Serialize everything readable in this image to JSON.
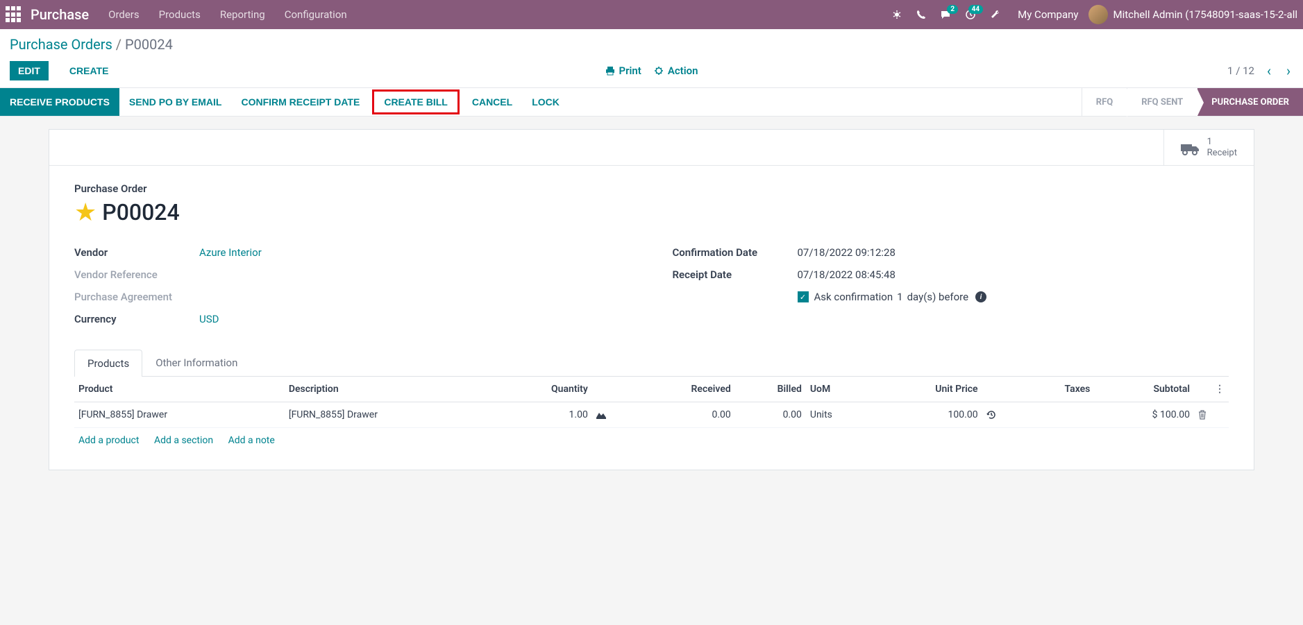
{
  "navbar": {
    "brand": "Purchase",
    "links": [
      "Orders",
      "Products",
      "Reporting",
      "Configuration"
    ],
    "badge_msg": "2",
    "badge_clock": "44",
    "company": "My Company",
    "user": "Mitchell Admin (17548091-saas-15-2-all"
  },
  "breadcrumb": {
    "root": "Purchase Orders",
    "current": "P00024"
  },
  "buttons": {
    "edit": "Edit",
    "create": "Create",
    "print": "Print",
    "action": "Action"
  },
  "pager": {
    "text": "1 / 12"
  },
  "actions": {
    "receive": "Receive Products",
    "send": "Send PO by Email",
    "confirm": "Confirm Receipt Date",
    "create_bill": "Create Bill",
    "cancel": "Cancel",
    "lock": "Lock"
  },
  "status": {
    "rfq": "RFQ",
    "sent": "RFQ SENT",
    "po": "PURCHASE ORDER"
  },
  "stat": {
    "count": "1",
    "label": "Receipt"
  },
  "order": {
    "title_label": "Purchase Order",
    "name": "P00024",
    "vendor_label": "Vendor",
    "vendor": "Azure Interior",
    "vendor_ref_label": "Vendor Reference",
    "agreement_label": "Purchase Agreement",
    "currency_label": "Currency",
    "currency": "USD",
    "confirm_date_label": "Confirmation Date",
    "confirm_date": "07/18/2022 09:12:28",
    "receipt_date_label": "Receipt Date",
    "receipt_date": "07/18/2022 08:45:48",
    "ask_confirm_prefix": "Ask confirmation",
    "ask_confirm_days": "1",
    "ask_confirm_suffix": "day(s) before"
  },
  "tabs": {
    "products": "Products",
    "other": "Other Information"
  },
  "table": {
    "headers": {
      "product": "Product",
      "desc": "Description",
      "qty": "Quantity",
      "recv": "Received",
      "billed": "Billed",
      "uom": "UoM",
      "price": "Unit Price",
      "taxes": "Taxes",
      "subtotal": "Subtotal"
    },
    "rows": [
      {
        "product": "[FURN_8855] Drawer",
        "desc": "[FURN_8855] Drawer",
        "qty": "1.00",
        "recv": "0.00",
        "billed": "0.00",
        "uom": "Units",
        "price": "100.00",
        "subtotal": "$ 100.00"
      }
    ],
    "add_product": "Add a product",
    "add_section": "Add a section",
    "add_note": "Add a note"
  }
}
